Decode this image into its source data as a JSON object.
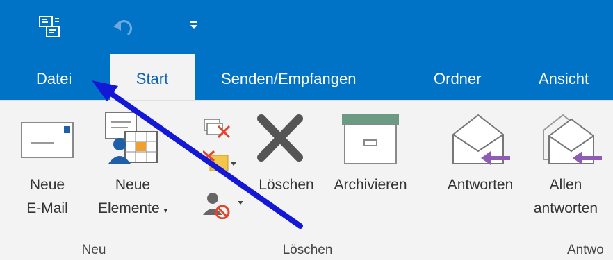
{
  "window": {
    "title": ""
  },
  "qat": {
    "icons": [
      "send-receive-all-folders-icon",
      "undo-icon",
      "customize-qat-caret-icon"
    ],
    "caret_glyph": "▾"
  },
  "tabs": [
    {
      "label": "Datei"
    },
    {
      "label": "Start",
      "active": true
    },
    {
      "label": "Senden/Empfangen"
    },
    {
      "label": "Ordner"
    },
    {
      "label": "Ansicht"
    }
  ],
  "ribbon": {
    "groups": {
      "neu": {
        "label": "Neu",
        "new_email_line1": "Neue",
        "new_email_line2": "E-Mail",
        "new_items_line1": "Neue",
        "new_items_line2": "Elemente"
      },
      "loeschen": {
        "label": "Löschen",
        "delete": "Löschen",
        "archive": "Archivieren"
      },
      "antworten": {
        "label": "Antwo",
        "reply": "Antworten",
        "reply_all_line1": "Allen",
        "reply_all_line2": "antworten"
      }
    }
  },
  "annotation": {
    "color": "#1218d6"
  },
  "colors": {
    "ribbon_blue": "#0173c7",
    "ribbon_bg": "#f3f3f3",
    "reply_arrow": "#8e5bb5",
    "delete_red": "#e2442b"
  }
}
